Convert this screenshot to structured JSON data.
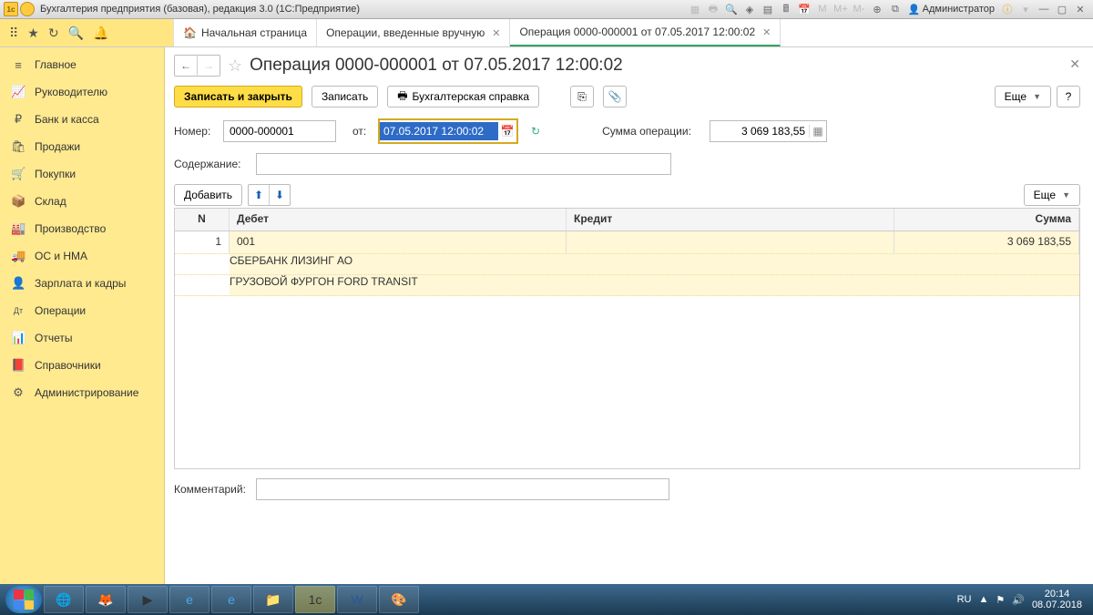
{
  "titlebar": {
    "app_title": "Бухгалтерия предприятия (базовая), редакция 3.0  (1С:Предприятие)",
    "admin": "Администратор"
  },
  "tabs": {
    "home": "Начальная страница",
    "t1": "Операции, введенные вручную",
    "t2": "Операция 0000-000001 от 07.05.2017 12:00:02"
  },
  "sidebar": [
    {
      "icon": "≡",
      "label": "Главное"
    },
    {
      "icon": "📈",
      "label": "Руководителю"
    },
    {
      "icon": "₽",
      "label": "Банк и касса"
    },
    {
      "icon": "🛍",
      "label": "Продажи"
    },
    {
      "icon": "🛒",
      "label": "Покупки"
    },
    {
      "icon": "📦",
      "label": "Склад"
    },
    {
      "icon": "🏭",
      "label": "Производство"
    },
    {
      "icon": "🚚",
      "label": "ОС и НМА"
    },
    {
      "icon": "👤",
      "label": "Зарплата и кадры"
    },
    {
      "icon": "Дт",
      "label": "Операции"
    },
    {
      "icon": "📊",
      "label": "Отчеты"
    },
    {
      "icon": "📕",
      "label": "Справочники"
    },
    {
      "icon": "⚙",
      "label": "Администрирование"
    }
  ],
  "page": {
    "title": "Операция 0000-000001 от 07.05.2017 12:00:02",
    "save_close": "Записать и закрыть",
    "save": "Записать",
    "acc_report": "Бухгалтерская справка",
    "more": "Еще",
    "help": "?",
    "num_label": "Номер:",
    "num_value": "0000-000001",
    "date_label": "от:",
    "date_value": "07.05.2017 12:00:02",
    "sum_label": "Сумма операции:",
    "sum_value": "3 069 183,55",
    "content_label": "Содержание:",
    "content_value": "",
    "add": "Добавить",
    "cols": {
      "n": "N",
      "debit": "Дебет",
      "credit": "Кредит",
      "sum": "Сумма"
    },
    "row": {
      "n": "1",
      "acc": "001",
      "sum": "3 069 183,55",
      "sub1": "СБЕРБАНК ЛИЗИНГ АО",
      "sub2": "ГРУЗОВОЙ ФУРГОН FORD TRANSIT"
    },
    "comment_label": "Комментарий:",
    "comment_value": ""
  },
  "tray": {
    "lang": "RU",
    "time": "20:14",
    "date": "08.07.2018"
  }
}
